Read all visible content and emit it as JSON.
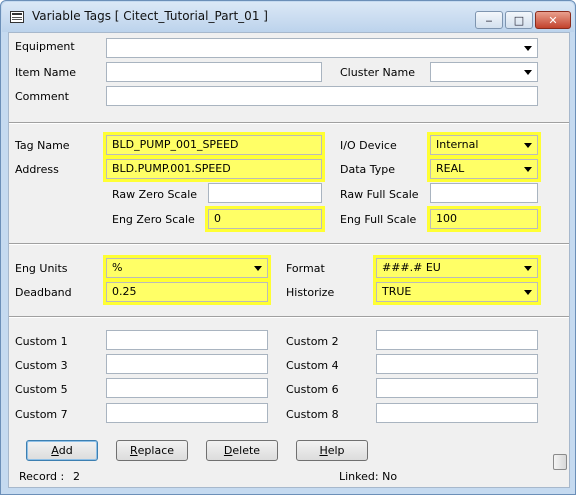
{
  "window": {
    "title": "Variable Tags [ Citect_Tutorial_Part_01 ]",
    "icon": "table-window-icon"
  },
  "titlebar_controls": {
    "minimize": "minimize-icon",
    "maximize": "maximize-icon",
    "close": "close-icon"
  },
  "section1": {
    "equipment_label": "Equipment",
    "equipment_value": "",
    "item_name_label": "Item Name",
    "item_name_value": "",
    "cluster_name_label": "Cluster Name",
    "cluster_name_value": "",
    "comment_label": "Comment",
    "comment_value": ""
  },
  "section2": {
    "tag_name_label": "Tag Name",
    "tag_name_value": "BLD_PUMP_001_SPEED",
    "address_label": "Address",
    "address_value": "BLD.PUMP.001.SPEED",
    "io_device_label": "I/O Device",
    "io_device_value": "Internal",
    "data_type_label": "Data Type",
    "data_type_value": "REAL",
    "raw_zero_label": "Raw Zero Scale",
    "raw_zero_value": "",
    "raw_full_label": "Raw Full Scale",
    "raw_full_value": "",
    "eng_zero_label": "Eng Zero Scale",
    "eng_zero_value": "0",
    "eng_full_label": "Eng Full Scale",
    "eng_full_value": "100"
  },
  "section3": {
    "eng_units_label": "Eng Units",
    "eng_units_value": "%",
    "deadband_label": "Deadband",
    "deadband_value": "0.25",
    "format_label": "Format",
    "format_value": "###.# EU",
    "historize_label": "Historize",
    "historize_value": "TRUE"
  },
  "section4": {
    "custom1_label": "Custom 1",
    "custom2_label": "Custom 2",
    "custom3_label": "Custom 3",
    "custom4_label": "Custom 4",
    "custom5_label": "Custom 5",
    "custom6_label": "Custom 6",
    "custom7_label": "Custom 7",
    "custom8_label": "Custom 8"
  },
  "buttons": {
    "add_pre": "",
    "add_key": "A",
    "add_post": "dd",
    "replace_pre": "",
    "replace_key": "R",
    "replace_post": "eplace",
    "delete_pre": "",
    "delete_key": "D",
    "delete_post": "elete",
    "help_pre": "",
    "help_key": "H",
    "help_post": "elp"
  },
  "status": {
    "record_label": "Record :",
    "record_value": "2",
    "linked": "Linked: No"
  },
  "colors": {
    "highlight": "#ffff66",
    "client_bg": "#f0f0f0",
    "frame": "#c5daf0"
  }
}
